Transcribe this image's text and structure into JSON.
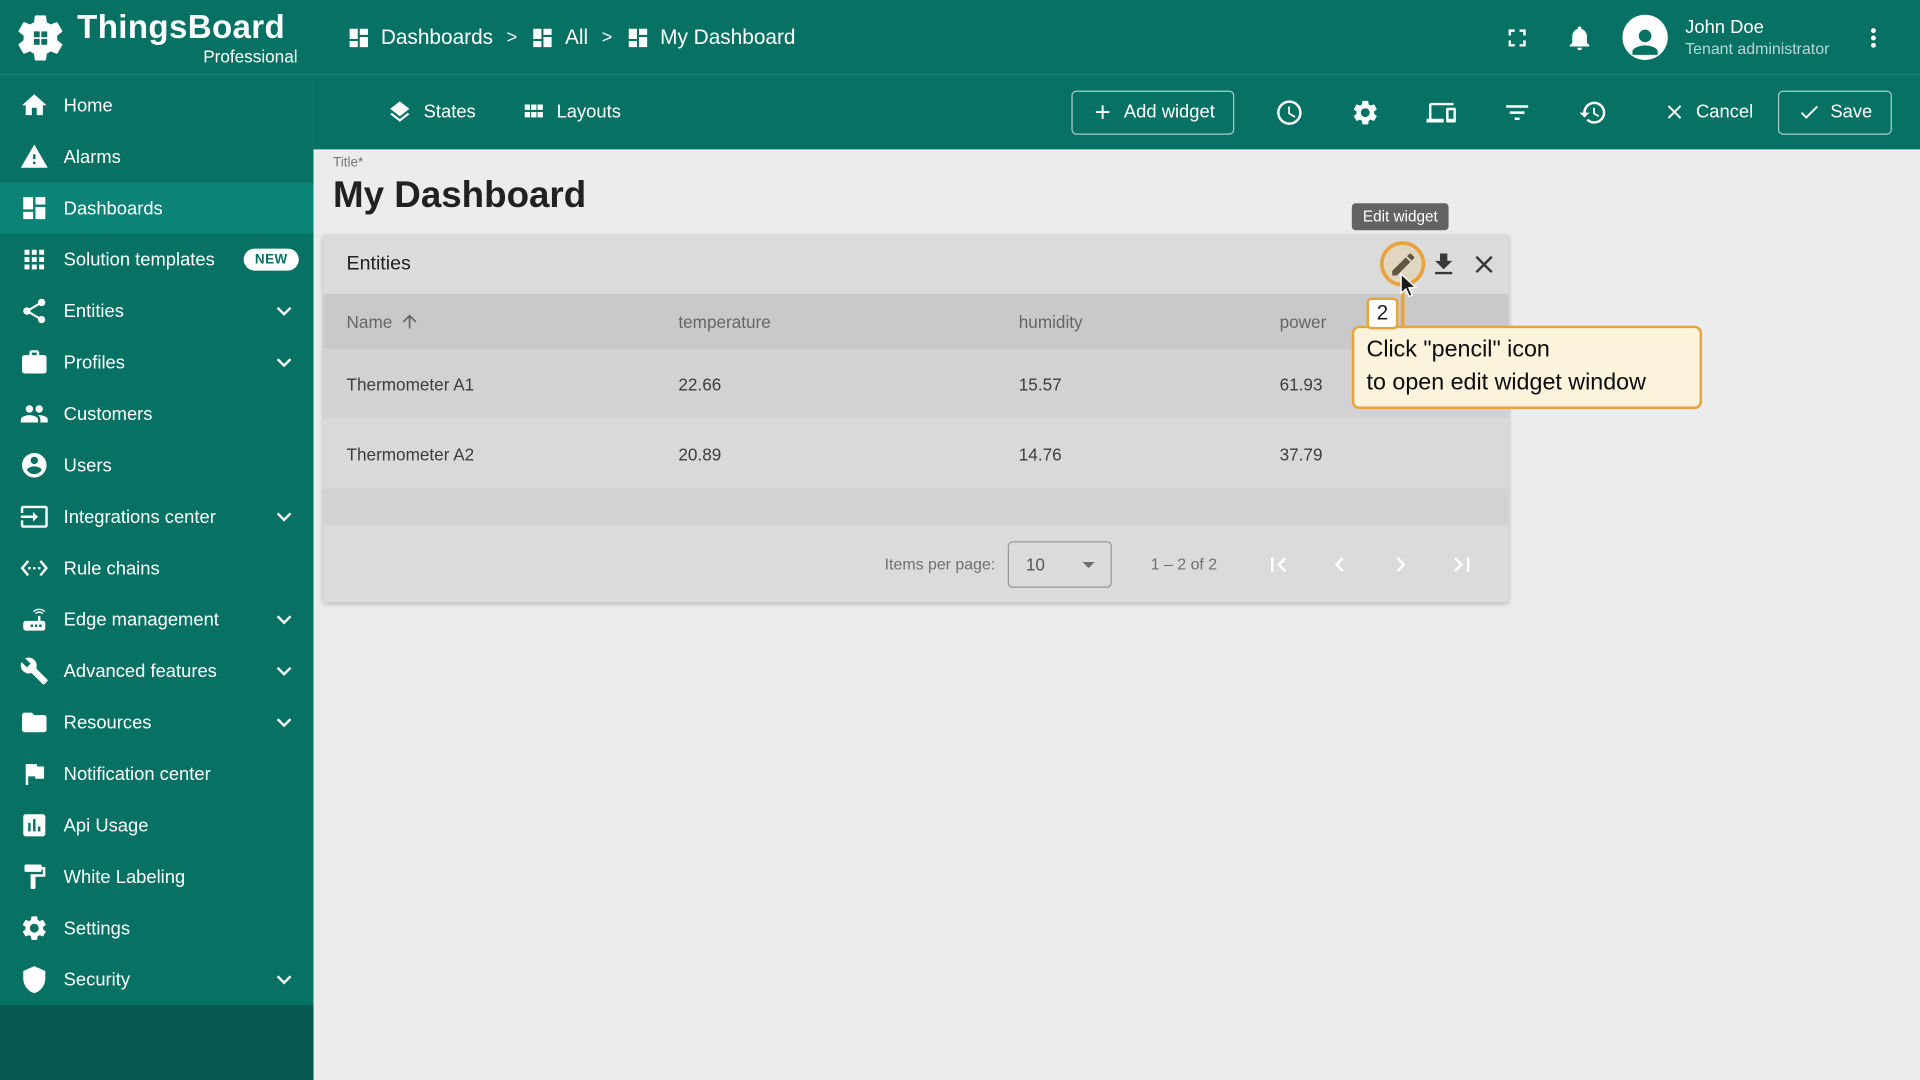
{
  "app": {
    "name": "ThingsBoard",
    "edition": "Professional"
  },
  "header": {
    "breadcrumb": [
      {
        "label": "Dashboards"
      },
      {
        "label": "All"
      },
      {
        "label": "My Dashboard"
      }
    ],
    "breadcrumb_separator": ">",
    "user": {
      "name": "John Doe",
      "role": "Tenant administrator"
    }
  },
  "toolbar": {
    "states": "States",
    "layouts": "Layouts",
    "add_widget": "Add widget",
    "cancel": "Cancel",
    "save": "Save"
  },
  "sidebar": {
    "items": [
      {
        "label": "Home"
      },
      {
        "label": "Alarms"
      },
      {
        "label": "Dashboards",
        "selected": true
      },
      {
        "label": "Solution templates",
        "badge": "NEW"
      },
      {
        "label": "Entities",
        "expandable": true
      },
      {
        "label": "Profiles",
        "expandable": true
      },
      {
        "label": "Customers"
      },
      {
        "label": "Users"
      },
      {
        "label": "Integrations center",
        "expandable": true
      },
      {
        "label": "Rule chains"
      },
      {
        "label": "Edge management",
        "expandable": true
      },
      {
        "label": "Advanced features",
        "expandable": true
      },
      {
        "label": "Resources",
        "expandable": true
      },
      {
        "label": "Notification center"
      },
      {
        "label": "Api Usage"
      },
      {
        "label": "White Labeling"
      },
      {
        "label": "Settings"
      },
      {
        "label": "Security",
        "expandable": true
      }
    ]
  },
  "dashboard": {
    "title_label": "Title*",
    "title": "My Dashboard"
  },
  "widget": {
    "title": "Entities",
    "table": {
      "columns": [
        "Name",
        "temperature",
        "humidity",
        "power"
      ],
      "rows": [
        {
          "name": "Thermometer A1",
          "temperature": "22.66",
          "humidity": "15.57",
          "power": "61.93"
        },
        {
          "name": "Thermometer A2",
          "temperature": "20.89",
          "humidity": "14.76",
          "power": "37.79"
        }
      ]
    },
    "pagination": {
      "items_per_page_label": "Items per page:",
      "page_size": "10",
      "range": "1 – 2 of 2"
    }
  },
  "annotation": {
    "tooltip": "Edit widget",
    "step": "2",
    "callout_line1": "Click \"pencil\" icon",
    "callout_line2": "to open edit widget window"
  },
  "colors": {
    "teal": "#077164",
    "tealSel": "#0B8376",
    "orange": "#E8A33D",
    "calloutBg": "#FCF3DC",
    "contentBg": "#ECECEC",
    "cardBg": "#DBDBDB"
  }
}
